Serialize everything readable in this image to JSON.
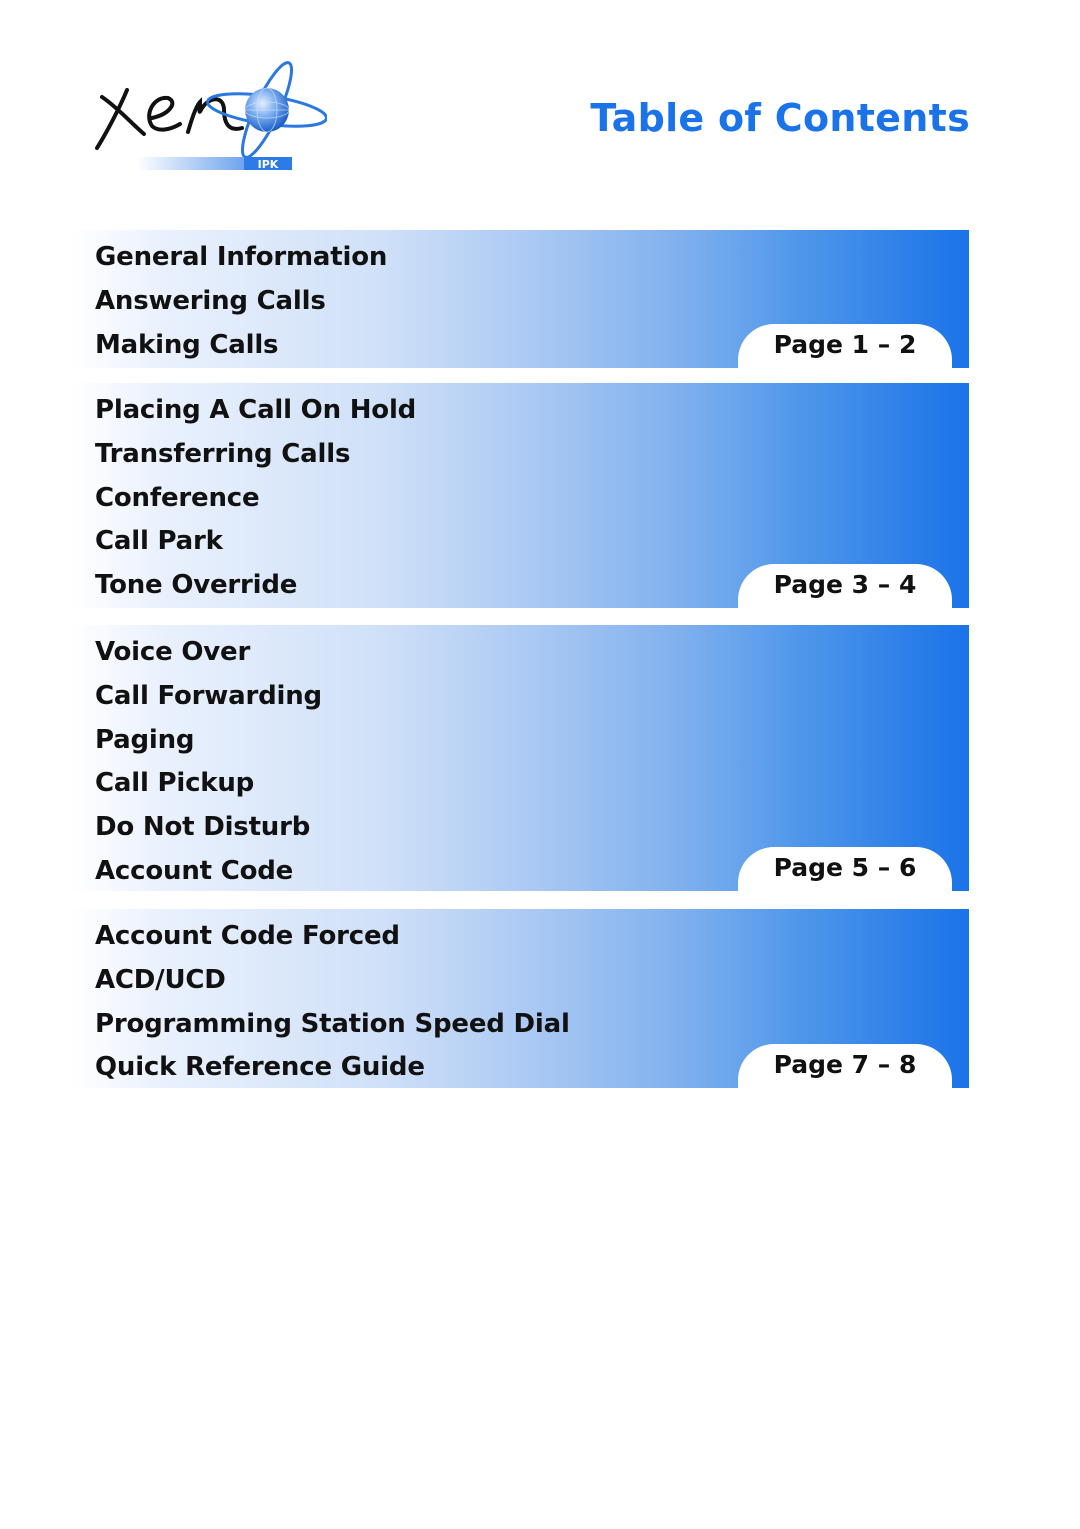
{
  "header": {
    "logo": {
      "wordmark": "Xen",
      "badge": "IPK",
      "icon": "globe-orbit-icon"
    },
    "title": "Table of Contents",
    "title_color": "#1a73e8"
  },
  "sections": [
    {
      "items": [
        "General Information",
        "Answering Calls",
        "Making Calls"
      ],
      "pages": "Page 1 – 2"
    },
    {
      "items": [
        "Placing A Call On Hold",
        "Transferring Calls",
        "Conference",
        "Call Park",
        "Tone Override"
      ],
      "pages": "Page 3 – 4"
    },
    {
      "items": [
        "Voice Over",
        "Call Forwarding",
        "Paging",
        "Call Pickup",
        "Do Not Disturb",
        "Account Code"
      ],
      "pages": "Page 5 – 6"
    },
    {
      "items": [
        "Account Code Forced",
        "ACD/UCD",
        "Programming Station Speed Dial",
        "Quick Reference Guide"
      ],
      "pages": "Page 7 – 8"
    }
  ],
  "colors": {
    "accent": "#1a73e8",
    "text": "#111111",
    "background": "#ffffff"
  }
}
